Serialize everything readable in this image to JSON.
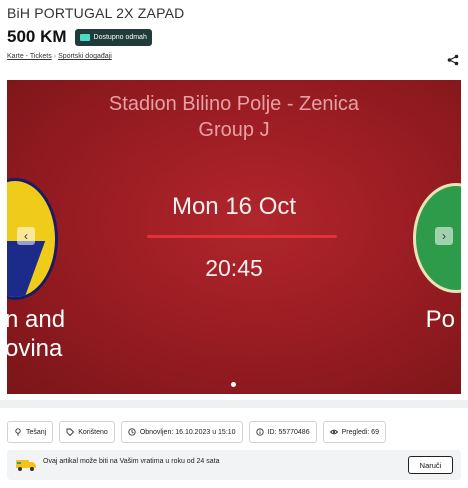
{
  "listing": {
    "title": "BiH PORTUGAL 2X ZAPAD",
    "price": "500 KM",
    "delivery_badge": "Dostupno odmah"
  },
  "breadcrumbs": [
    "Karte - Tickets",
    "Sportski događaji"
  ],
  "gallery": {
    "stadium": "Stadion Bilino Polje  -  Zenica",
    "group": "Group J",
    "date": "Mon 16 Oct",
    "time": "20:45",
    "team_left_line1": "n and",
    "team_left_line2": "ovina",
    "team_right": "Po",
    "prev_arrow": "‹",
    "next_arrow": "›"
  },
  "details": {
    "location": "Tešanj",
    "condition": "Korišteno",
    "updated": "Obnovljen: 16.10.2023 u 15:10",
    "id": "ID: 55770486",
    "views": "Pregledi: 69"
  },
  "return_notice": {
    "text": "Ovaj artikal može biti na Vašim vratima u roku od 24 sata",
    "button": "Naruči"
  },
  "colors": {
    "banner_red": "#9b1d23",
    "badge_dark": "#1f3b3a",
    "accent_line": "#e0323a"
  }
}
